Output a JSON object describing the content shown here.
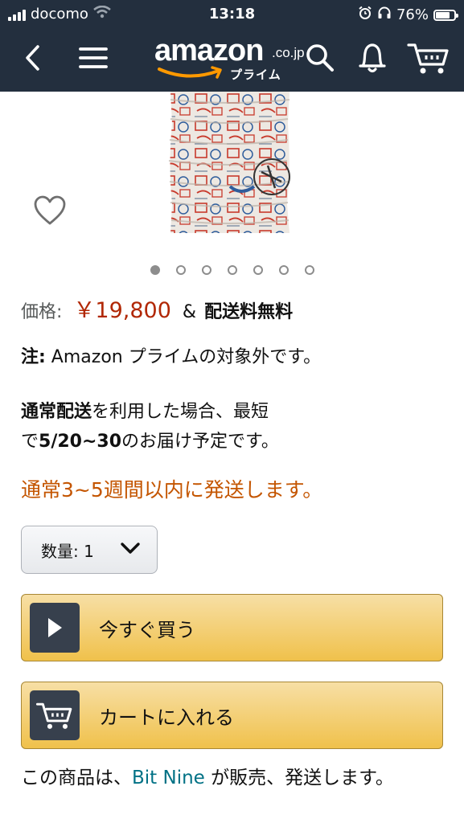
{
  "status_bar": {
    "carrier": "docomo",
    "time": "13:18",
    "battery_text": "76%",
    "battery_level": 0.76
  },
  "nav": {
    "logo_word": "amazon",
    "logo_suffix": ".co.jp",
    "logo_prime": "プライム",
    "icons": [
      "back-icon",
      "menu-icon",
      "search-icon",
      "bell-icon",
      "cart-icon"
    ]
  },
  "gallery": {
    "image_count": 7,
    "active_index": 0
  },
  "price": {
    "label": "価格:",
    "value": "￥19,800",
    "amp": "&",
    "shipping": "配送料無料"
  },
  "note": {
    "prefix": "注:",
    "text": " Amazon プライムの対象外です。"
  },
  "delivery": {
    "bold1": "通常配送",
    "text1": "を利用した場合、最短",
    "text2": "で",
    "bold2": "5/20~30",
    "text3": "のお届け予定です。"
  },
  "availability": "通常3~5週間以内に発送します。",
  "quantity": {
    "label": "数量: 1"
  },
  "buttons": {
    "buy_now": "今すぐ買う",
    "add_to_cart": "カートに入れる"
  },
  "seller": {
    "prefix": "この商品は、",
    "name": "Bit Nine",
    "suffix": " が販売、発送します。"
  },
  "colors": {
    "nav_bg": "#232f3e",
    "price": "#b12704",
    "availability": "#c45500",
    "link": "#007185",
    "button": "#f0c14b"
  }
}
